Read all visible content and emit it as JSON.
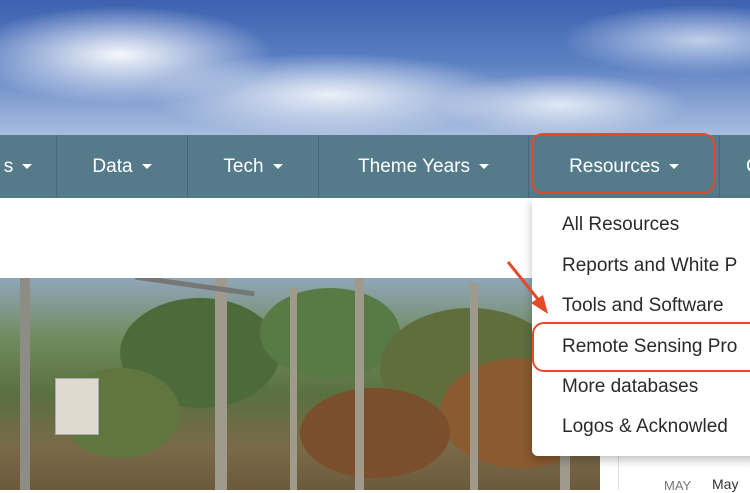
{
  "navbar": {
    "items": [
      {
        "label": "s"
      },
      {
        "label": "Data"
      },
      {
        "label": "Tech"
      },
      {
        "label": "Theme Years"
      },
      {
        "label": "Resources"
      },
      {
        "label": "C"
      }
    ]
  },
  "dropdown": {
    "items": [
      {
        "label": "All Resources"
      },
      {
        "label": "Reports and White P"
      },
      {
        "label": "Tools and Software"
      },
      {
        "label": "Remote Sensing Pro"
      },
      {
        "label": "More databases"
      },
      {
        "label": "Logos & Acknowled"
      }
    ]
  },
  "side_panel": {
    "month": "MAY",
    "text": "May"
  },
  "colors": {
    "navbar": "#557b8b",
    "highlight": "#e24a2a"
  }
}
